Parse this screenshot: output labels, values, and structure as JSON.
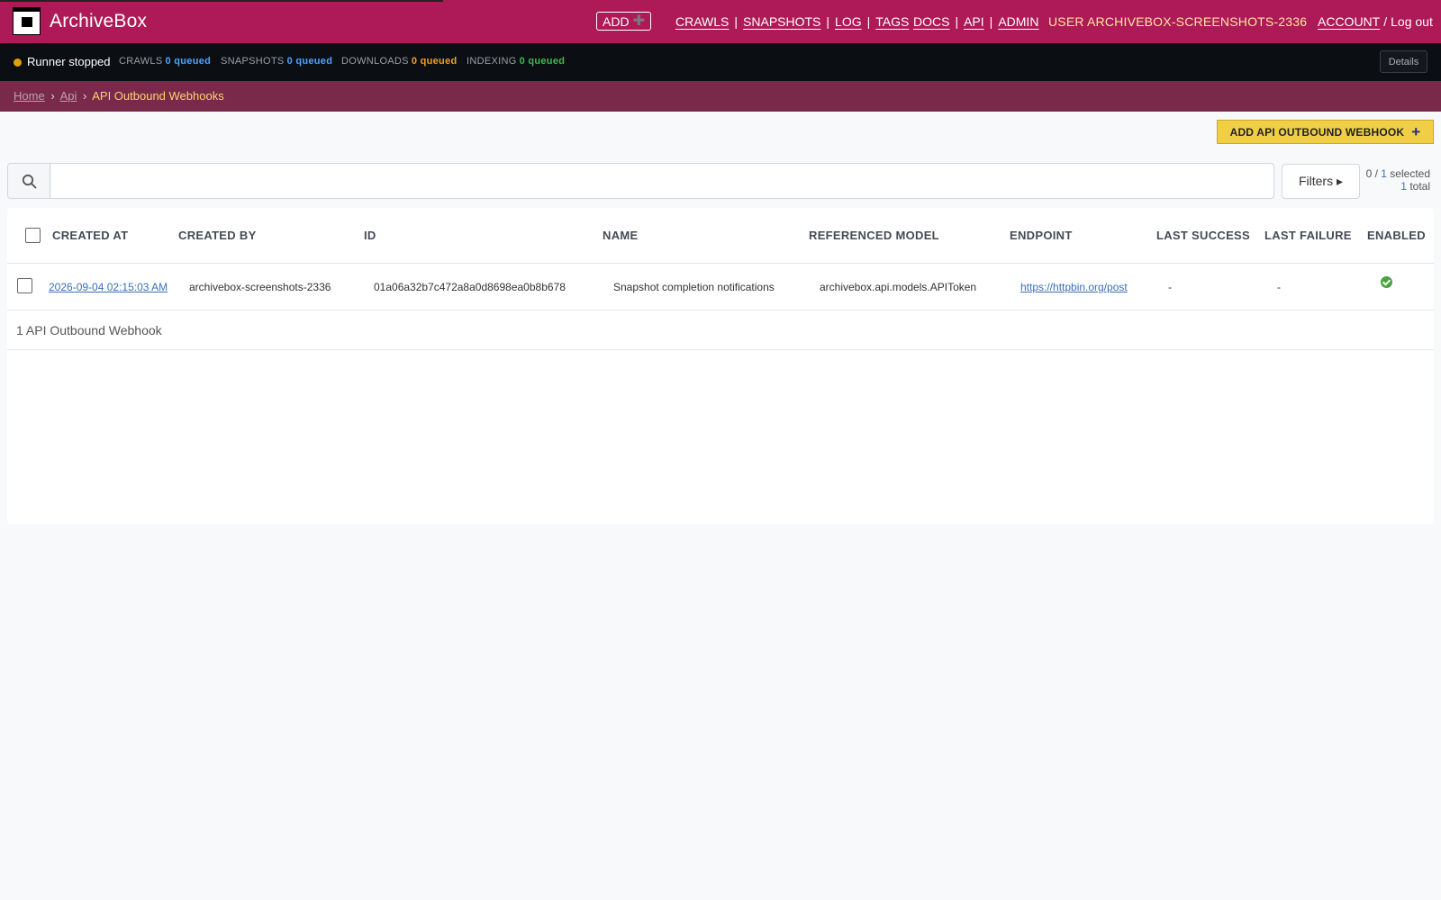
{
  "header": {
    "brand": "ArchiveBox",
    "add_label": "ADD",
    "nav": [
      "CRAWLS",
      "SNAPSHOTS",
      "LOG",
      "TAGS"
    ],
    "nav2": [
      "DOCS",
      "API",
      "ADMIN"
    ],
    "user": "USER ARCHIVEBOX-SCREENSHOTS-2336",
    "account": "ACCOUNT",
    "logout": "Log out",
    "slash": "/"
  },
  "status": {
    "runner": "Runner stopped",
    "queues": [
      {
        "label": "CRAWLS",
        "value": "0 queued",
        "color": "#4da3ff"
      },
      {
        "label": "SNAPSHOTS",
        "value": "0 queued",
        "color": "#4da3ff"
      },
      {
        "label": "DOWNLOADS",
        "value": "0 queued",
        "color": "#f0a020"
      },
      {
        "label": "INDEXING",
        "value": "0 queued",
        "color": "#3fb950"
      }
    ],
    "details": "Details"
  },
  "breadcrumb": {
    "home": "Home",
    "api": "Api",
    "current": "API Outbound Webhooks",
    "sep": "›"
  },
  "add_object": "ADD API OUTBOUND WEBHOOK",
  "search": {
    "placeholder": ""
  },
  "filters": "Filters ▸",
  "selection": {
    "prefix": "0 / ",
    "count": "1",
    "suffix": " selected",
    "total_count": "1",
    "total_suffix": " total"
  },
  "table": {
    "columns": [
      "CREATED AT",
      "CREATED BY",
      "ID",
      "NAME",
      "REFERENCED MODEL",
      "ENDPOINT",
      "LAST SUCCESS",
      "LAST FAILURE",
      "ENABLED"
    ],
    "rows": [
      {
        "created_at": "2026-09-04 02:15:03 AM",
        "created_by": "archivebox-screenshots-2336",
        "id": "01a06a32b7c472a8a0d8698ea0b8b678",
        "name": "Snapshot completion notifications",
        "model": "archivebox.api.models.APIToken",
        "endpoint": "https://httpbin.org/post",
        "last_success": "-",
        "last_failure": "-",
        "enabled": "check-circle-icon"
      }
    ],
    "footer": "1 API Outbound Webhook"
  }
}
